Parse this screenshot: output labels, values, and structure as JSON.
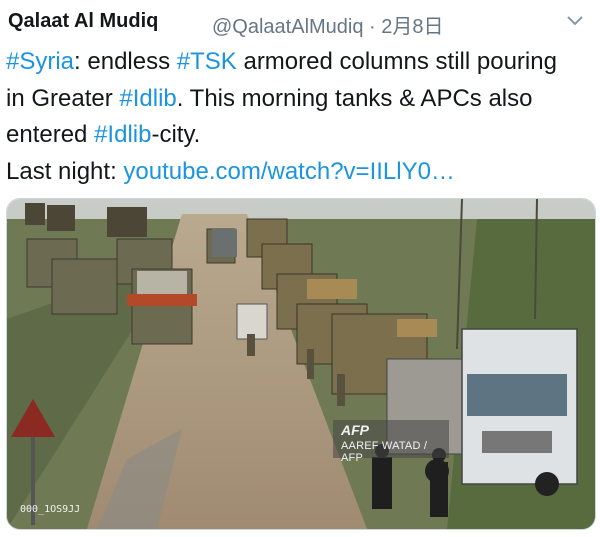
{
  "author": {
    "display_name": "Qalaat Al Mudiq",
    "handle": "@QalaatAlMudiq",
    "separator": "·",
    "date": "2月8日"
  },
  "menu": {
    "icon": "chevron-down-icon"
  },
  "tweet": {
    "line1": {
      "hash1": "#Syria",
      "text1": ": endless ",
      "hash2": "#TSK",
      "text2": " armored columns still pouring"
    },
    "line2": {
      "text1": "in Greater ",
      "hash1": "#Idlib",
      "text2": ". This morning tanks & APCs also"
    },
    "line3": {
      "text1": "entered ",
      "hash1": "#Idlib",
      "text2": "-city."
    },
    "line4": {
      "text1": "Last night: ",
      "link": "youtube.com/watch?v=IILlY0…"
    }
  },
  "media": {
    "watermark_logo": "AFP",
    "watermark_credit": "AAREF WATAD / AFP",
    "image_id": "000_1OS9JJ"
  },
  "colors": {
    "link": "#1b95e0",
    "text": "#14171a",
    "muted": "#657786"
  }
}
